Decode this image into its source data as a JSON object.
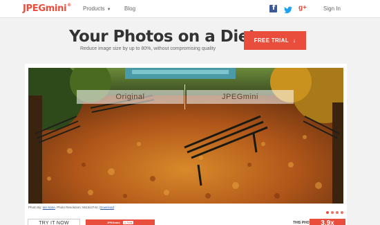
{
  "nav": {
    "logo": "JPEGmini",
    "logo_mark": "®",
    "products": "Products",
    "blog": "Blog",
    "signin": "Sign In",
    "social_icons": [
      "facebook-icon",
      "twitter-icon",
      "googleplus-icon"
    ],
    "gplus_glyph": "g+"
  },
  "hero": {
    "title": "Your Photos on a Diet",
    "subtitle": "Reduce image size by up to 80%, without compromising quality",
    "cta_label": "FREE TRIAL",
    "cta_arrow": "↓"
  },
  "photo": {
    "label_original": "Original",
    "label_jpegmini": "JPEGmini",
    "credit_prefix": "Photo By:",
    "credit_author": "Ian Sane",
    "credit_resolution": ", Photo Resolution: 5613x3744 |",
    "credit_download": "Download",
    "slide_count": 4
  },
  "bottom": {
    "try_label": "TRY IT NOW",
    "mini_logo": "JPEGmini",
    "mini_tag": "4.7MB",
    "this_photo": "THIS PHOTO",
    "ratio": "3.9x"
  },
  "colors": {
    "accent": "#e94e3c",
    "facebook": "#3b5998",
    "twitter": "#1da1f2",
    "googleplus": "#dd4b39"
  }
}
